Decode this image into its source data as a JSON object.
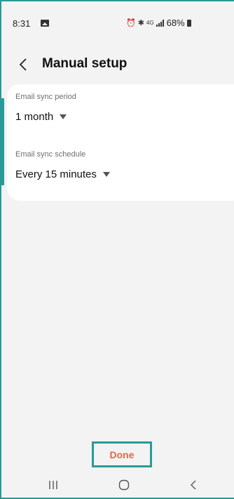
{
  "status_bar": {
    "time": "8:31",
    "network": "4G",
    "battery": "68%",
    "icons": [
      "gallery-icon",
      "alarm-icon",
      "bluetooth-icon",
      "volte-icon",
      "signal-icon",
      "battery-icon"
    ]
  },
  "header": {
    "title": "Manual setup",
    "back_icon": "back-chevron-icon"
  },
  "settings": {
    "sync_period": {
      "label": "Email sync period",
      "value": "1 month"
    },
    "sync_schedule": {
      "label": "Email sync schedule",
      "value": "Every 15 minutes"
    }
  },
  "footer": {
    "done_label": "Done"
  },
  "navigation": {
    "items": [
      "recents-icon",
      "home-icon",
      "back-icon"
    ]
  },
  "colors": {
    "accent": "#2a9a98",
    "done_text": "#e0674a",
    "background": "#f3f3f3",
    "card": "#ffffff"
  }
}
